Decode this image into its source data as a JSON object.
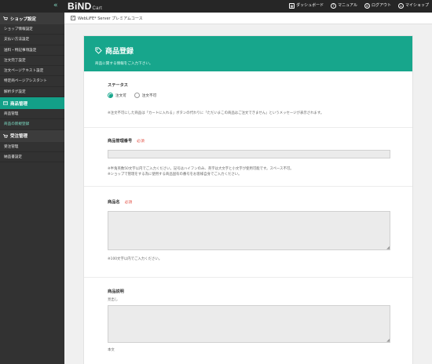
{
  "topbar": {
    "collapse_icon": "double-chevron-left-icon",
    "logo_main": "BiND",
    "logo_sub": "Cart",
    "nav": [
      {
        "icon": "dashboard-icon",
        "glyph": "▦",
        "label": "ダッシュボード"
      },
      {
        "icon": "help-icon",
        "glyph": "?",
        "label": "マニュアル"
      },
      {
        "icon": "logout-icon",
        "glyph": "⏻",
        "label": "ログアウト"
      },
      {
        "icon": "home-icon",
        "glyph": "⌂",
        "label": "マイショップ"
      }
    ]
  },
  "subbar": {
    "label": "WebLiFE* Server プレミアムコース"
  },
  "sidebar": {
    "sections": [
      {
        "title": "ショップ設定",
        "icon": "cart-icon",
        "items": [
          "ショップ情報設定",
          "支払い方法設定",
          "送料・特記事項設定",
          "注文完了設定",
          "注文ページテキスト設定",
          "特定商ページアシスタント",
          "解析タグ設定"
        ]
      },
      {
        "title": "商品管理",
        "icon": "product-icon",
        "items": [
          "商品管理",
          "商品の新規登録"
        ]
      },
      {
        "title": "受注管理",
        "icon": "order-icon",
        "items": [
          "受注管理",
          "納品書設定"
        ]
      }
    ],
    "active_item": "商品の新規登録"
  },
  "form": {
    "title": "商品登録",
    "title_icon": "tag-icon",
    "subtitle": "商品に関する情報をご入力下さい。",
    "status": {
      "label": "ステータス",
      "options": [
        {
          "label": "注文可",
          "checked": true
        },
        {
          "label": "注文不可",
          "checked": false
        }
      ],
      "note": "※注文不可にした商品は「カートに入れる」ボタンの代わりに「ただいまこの商品はご注文できません」というメッセージが表示されます。"
    },
    "product_code": {
      "label": "商品管理番号",
      "required": "必須",
      "value": "",
      "note1": "※半角英数50文字以内でご入力ください。記号はハイフンのみ、英字は大文字と小文字が使用可能です。スペース不可。",
      "note2": "※ショップで管理をする為に使用する商品固有の番号をお客様自身でご入力ください。"
    },
    "product_name": {
      "label": "商品名",
      "required": "必須",
      "value": "",
      "note": "※100文字以内でご入力ください。"
    },
    "description": {
      "label": "商品説明",
      "heading_label": "見出し",
      "heading_value": "",
      "body_label": "本文"
    }
  },
  "colors": {
    "accent": "#17a68c",
    "sidebar_bg": "#323232",
    "topbar_bg": "#262626",
    "required": "#e0463a"
  }
}
